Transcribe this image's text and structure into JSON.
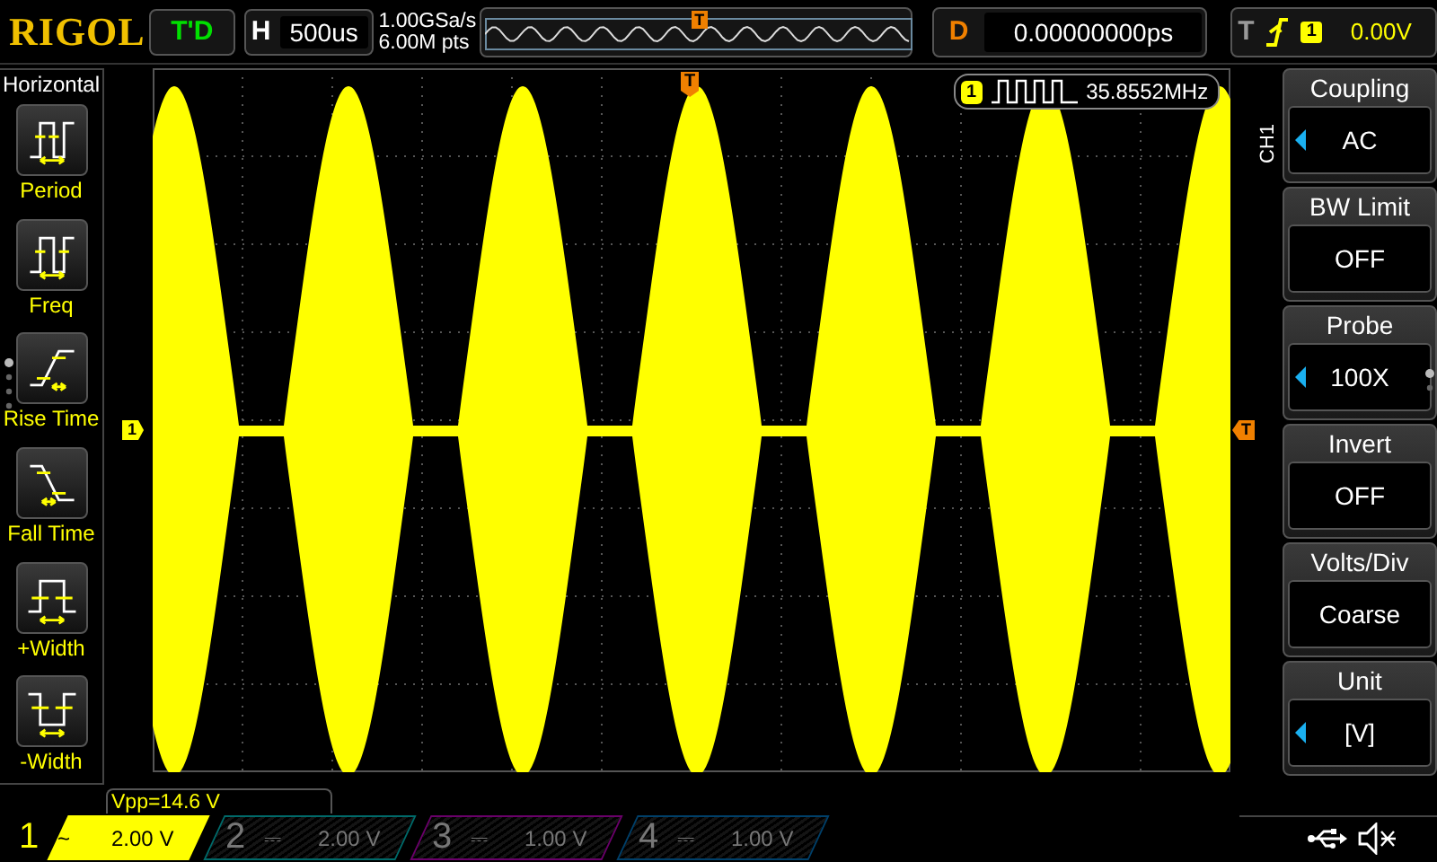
{
  "logo": "RIGOL",
  "run_status": "T'D",
  "timebase": {
    "label": "H",
    "value": "500us"
  },
  "sample_rate": "1.00GSa/s",
  "memory_depth": "6.00M pts",
  "memory_trigger_marker": "T",
  "delay": {
    "label": "D",
    "value": "0.00000000ps"
  },
  "trigger": {
    "label": "T",
    "source": "1",
    "value": "0.00V"
  },
  "measure_menu": {
    "title": "Horizontal",
    "items": [
      {
        "kind": "period",
        "label": "Period"
      },
      {
        "kind": "freq",
        "label": "Freq"
      },
      {
        "kind": "rise",
        "label": "Rise Time"
      },
      {
        "kind": "fall",
        "label": "Fall Time"
      },
      {
        "kind": "pwidth",
        "label": "+Width"
      },
      {
        "kind": "nwidth",
        "label": "-Width"
      }
    ]
  },
  "screen": {
    "trigger_marker": "T",
    "channel_marker": "1",
    "trigger_level_marker": "T",
    "frequency_counter": {
      "channel": "1",
      "value": "35.8552MHz"
    }
  },
  "channel_menu": {
    "channel": "CH1",
    "items": [
      {
        "title": "Coupling",
        "value": "AC",
        "adjustable": true
      },
      {
        "title": "BW Limit",
        "value": "OFF",
        "adjustable": false
      },
      {
        "title": "Probe",
        "value": "100X",
        "adjustable": true
      },
      {
        "title": "Invert",
        "value": "OFF",
        "adjustable": false
      },
      {
        "title": "Volts/Div",
        "value": "Coarse",
        "adjustable": false
      },
      {
        "title": "Unit",
        "value": "[V]",
        "adjustable": true
      }
    ]
  },
  "measurement": "Vpp=14.6 V",
  "channels": [
    {
      "number": "1",
      "coupling": "~",
      "scale": "2.00 V",
      "color": "#ffff00",
      "enabled": true
    },
    {
      "number": "2",
      "coupling": "⎓",
      "scale": "2.00 V",
      "color": "#006a6a",
      "enabled": false
    },
    {
      "number": "3",
      "coupling": "⎓",
      "scale": "1.00 V",
      "color": "#6a006a",
      "enabled": false
    },
    {
      "number": "4",
      "coupling": "⎓",
      "scale": "1.00 V",
      "color": "#00406a",
      "enabled": false
    }
  ]
}
